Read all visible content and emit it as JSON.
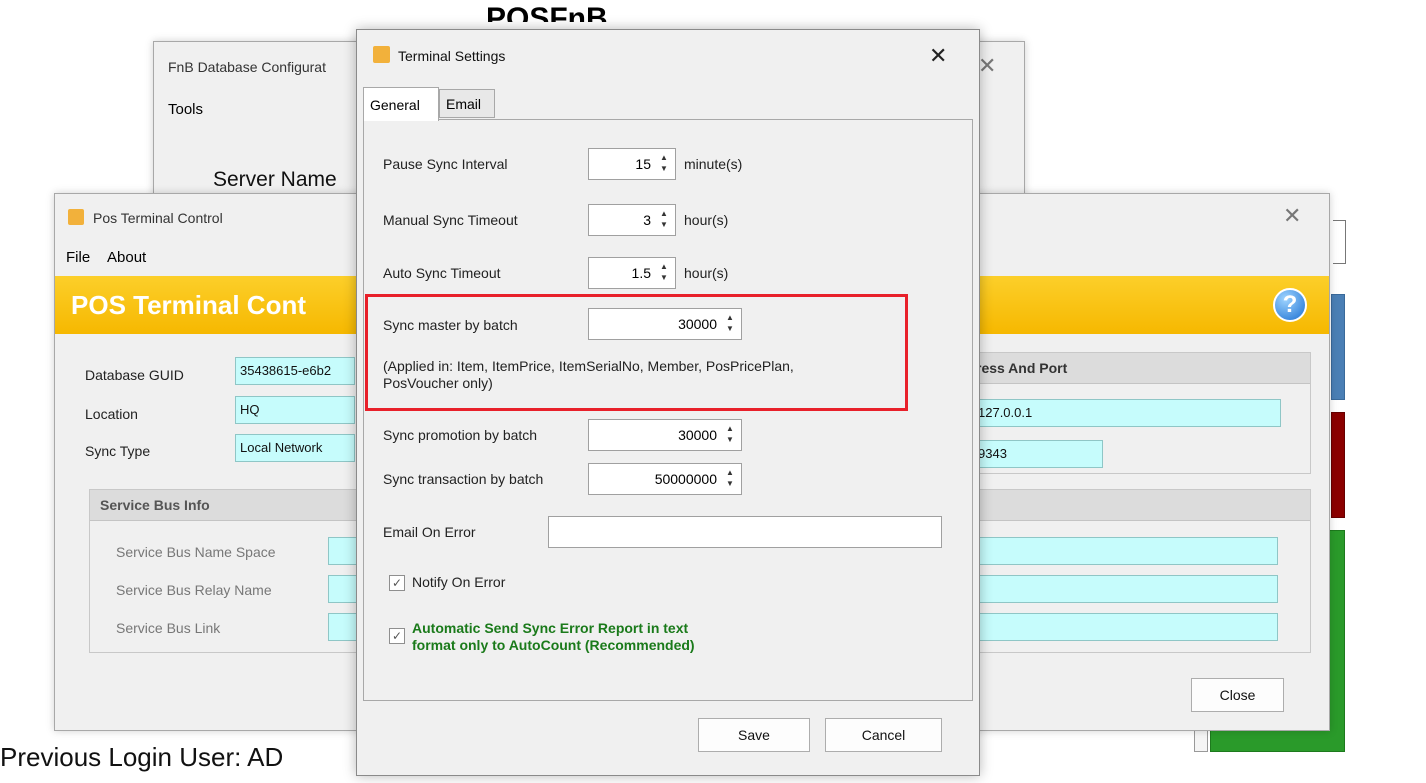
{
  "background": {
    "app_title": "POSFnB",
    "previous_login": "Previous Login User: AD"
  },
  "db_config_window": {
    "title": "FnB Database Configurat",
    "menu_tools": "Tools",
    "server_name_label": "Server Name"
  },
  "pos_terminal_window": {
    "title": "Pos Terminal Control",
    "menu": [
      "File",
      "About"
    ],
    "banner_title": "POS Terminal Cont",
    "banner_color": "#fcc200",
    "fields": [
      {
        "label": "Database GUID",
        "value": "35438615-e6b2"
      },
      {
        "label": "Location",
        "value": "HQ"
      },
      {
        "label": "Sync Type",
        "value": "Local Network"
      }
    ],
    "right_group_header": "ress And Port",
    "right_fields": [
      "127.0.0.1",
      "9343"
    ],
    "service_bus": {
      "header": "Service Bus Info",
      "labels": [
        "Service Bus Name Space",
        "Service Bus Relay Name",
        "Service Bus Link"
      ]
    },
    "close_label": "Close"
  },
  "terminal_settings": {
    "title": "Terminal Settings",
    "tabs": [
      "General",
      "Email"
    ],
    "active_tab": "General",
    "rows": [
      {
        "label": "Pause Sync Interval",
        "value": "15",
        "unit": "minute(s)"
      },
      {
        "label": "Manual Sync Timeout",
        "value": "3",
        "unit": "hour(s)"
      },
      {
        "label": "Auto Sync Timeout",
        "value": "1.5",
        "unit": "hour(s)"
      }
    ],
    "sync_master": {
      "label": "Sync master by batch",
      "value": "30000",
      "note_line1": "(Applied in: Item, ItemPrice, ItemSerialNo, Member, PosPricePlan,",
      "note_line2": "PosVoucher only)",
      "highlight_color": "#e8202a"
    },
    "sync_promotion": {
      "label": "Sync promotion by batch",
      "value": "30000"
    },
    "sync_transaction": {
      "label": "Sync transaction by batch",
      "value": "50000000"
    },
    "email_on_error": {
      "label": "Email On Error",
      "value": ""
    },
    "notify_on_error": {
      "label": "Notify On Error",
      "checked": true
    },
    "auto_send": {
      "line1": "Automatic Send Sync Error Report in text",
      "line2": "format only to AutoCount (Recommended)",
      "checked": true,
      "color": "#1a7a1a"
    },
    "save_label": "Save",
    "cancel_label": "Cancel"
  }
}
